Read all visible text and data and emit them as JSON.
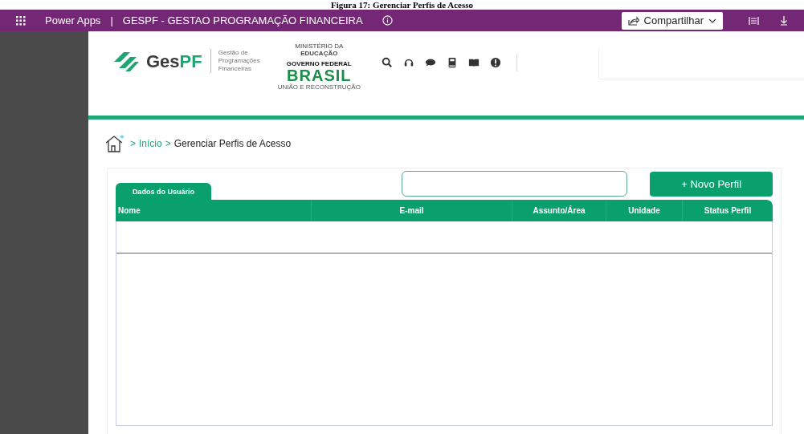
{
  "caption": "Figura 17: Gerenciar Perfis de Acesso",
  "app_bar": {
    "app_name": "Power Apps",
    "separator": "|",
    "title": "GESPF - GESTAO PROGRAMAÇÃO FINANCEIRA",
    "share_button": "Compartilhar"
  },
  "header": {
    "logo": {
      "part_1": "Ges",
      "part_2": "PF"
    },
    "logo_subtitle": [
      "Gestão de",
      "Programações",
      "Financeiras"
    ],
    "gov_logo": {
      "ministry_1": "MINISTÉRIO DA",
      "ministry_2": "EDUCAÇÃO",
      "government": "GOVERNO FEDERAL",
      "country": "BRASIL",
      "motto": "UNIÃO E RECONSTRUÇÃO"
    }
  },
  "breadcrumb": {
    "separator_1": ">",
    "home_link": "Início",
    "separator_2": ">",
    "current": "Gerenciar Perfis de Acesso"
  },
  "new_button": "+ Novo Perfil",
  "tabs": [
    {
      "label": "Dados do Usuário",
      "selected": true
    }
  ],
  "table": {
    "columns": [
      "Nome",
      "E-mail",
      "Assunto/Área",
      "Unidade",
      "Status Perfil"
    ]
  }
}
